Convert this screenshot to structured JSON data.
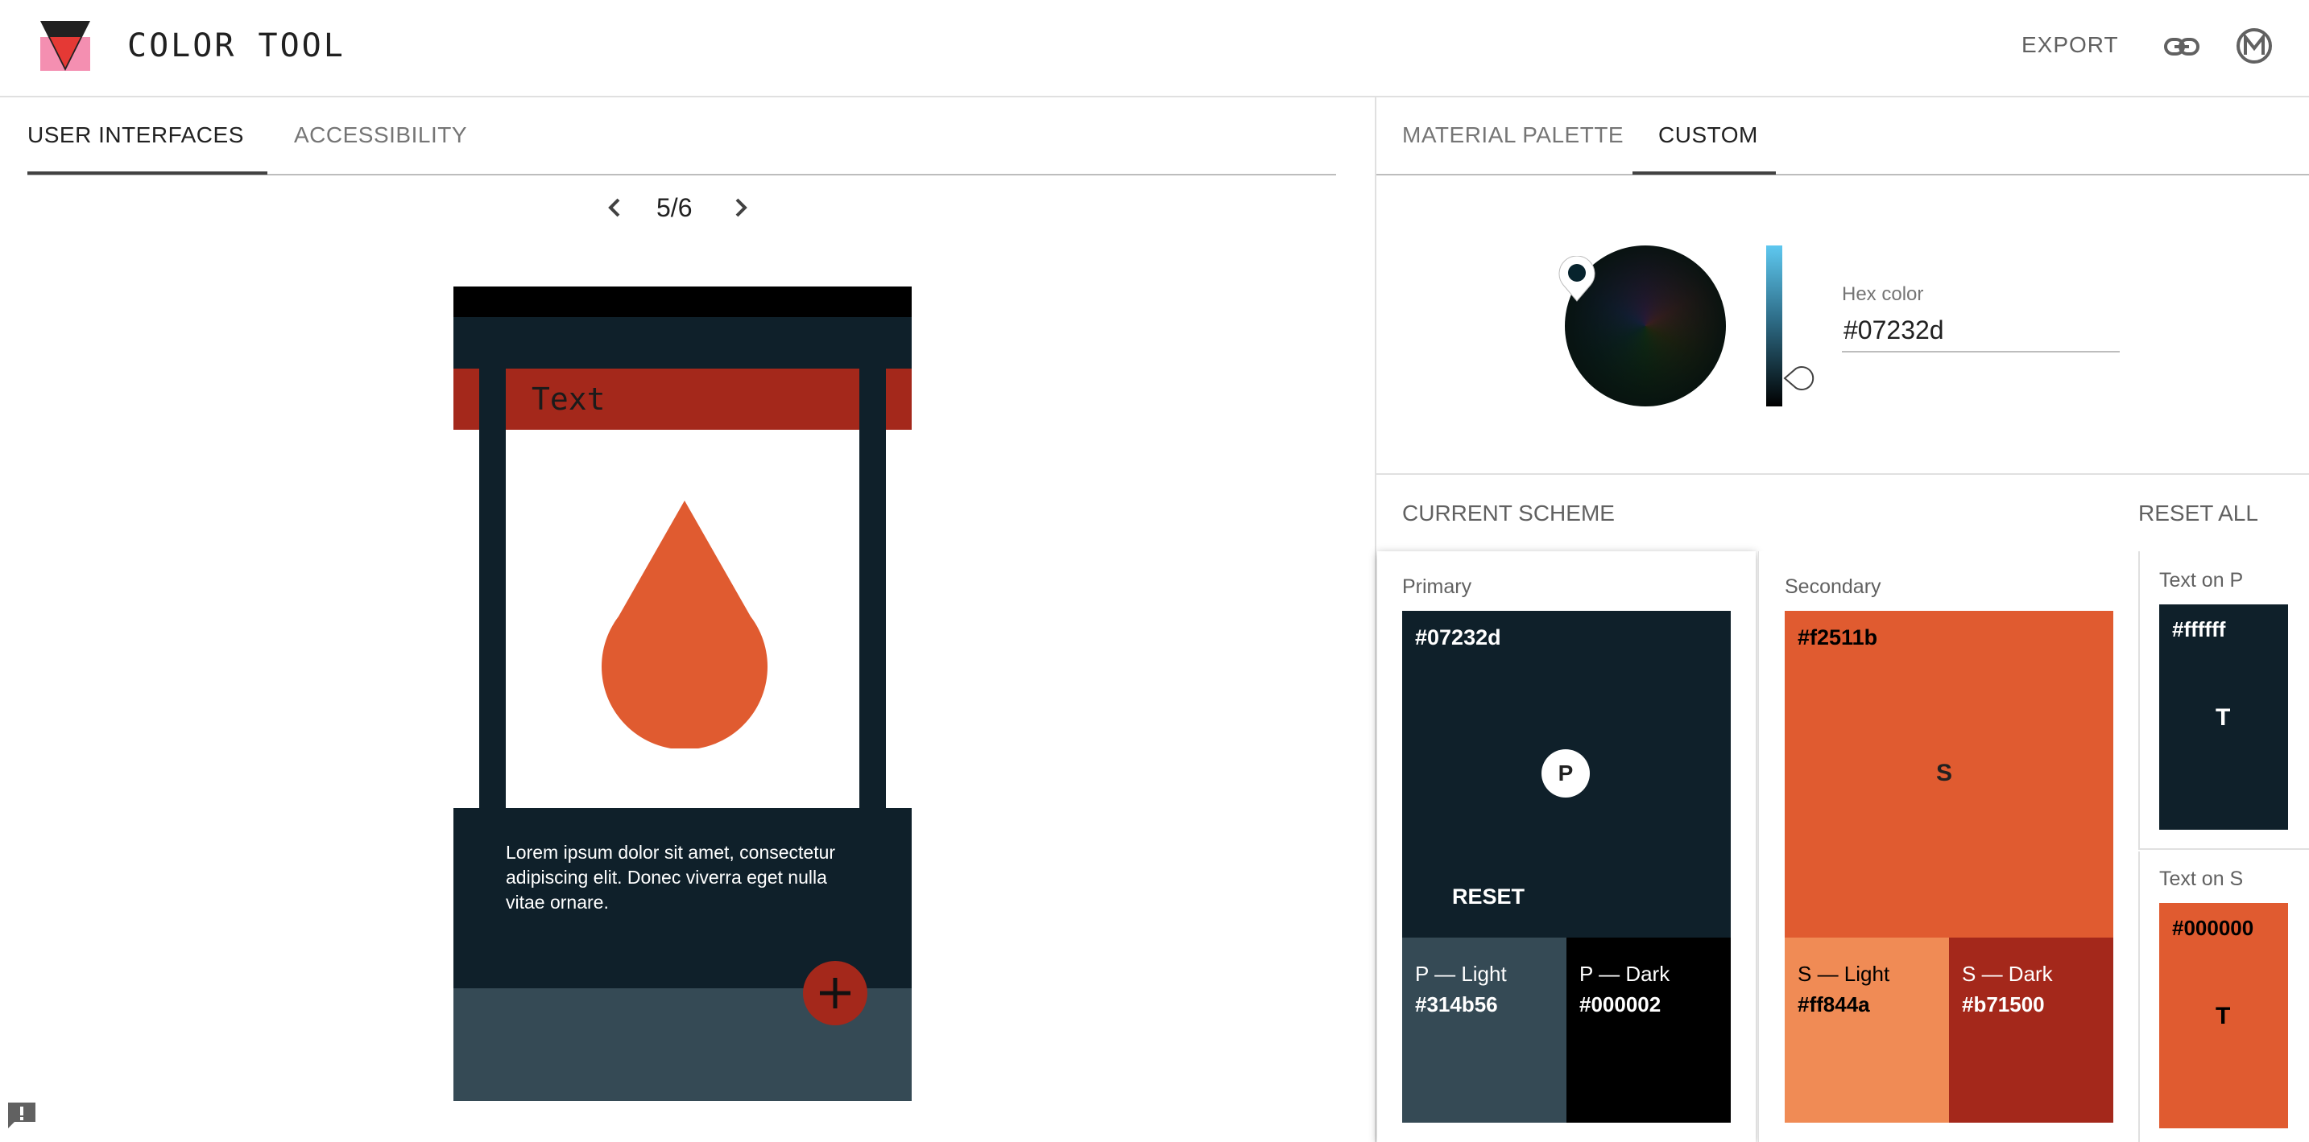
{
  "header": {
    "title": "COLOR TOOL",
    "export_label": "EXPORT",
    "link_icon": "link-icon",
    "material_icon": "material-icon"
  },
  "left_panel": {
    "tabs": [
      {
        "label": "USER INTERFACES",
        "active": true
      },
      {
        "label": "ACCESSIBILITY",
        "active": false
      }
    ],
    "pager": {
      "text": "5/6"
    },
    "preview": {
      "card_title": "Text",
      "body_text": "Lorem ipsum dolor sit amet, consectetur adipiscing elit. Donec viverra eget nulla vitae ornare.",
      "fab_icon": "plus-icon",
      "image_icon": "drop-icon"
    }
  },
  "right_panel": {
    "tabs": [
      {
        "label": "MATERIAL PALETTE",
        "active": false
      },
      {
        "label": "CUSTOM",
        "active": true
      }
    ],
    "picker": {
      "hex_label": "Hex color",
      "hex_value": "#07232d"
    },
    "scheme": {
      "title": "CURRENT SCHEME",
      "reset_all_label": "RESET ALL",
      "primary": {
        "label": "Primary",
        "hex": "#07232d",
        "badge": "P",
        "reset_label": "RESET",
        "light_title": "P — Light",
        "light_hex": "#314b56",
        "dark_title": "P — Dark",
        "dark_hex": "#000002"
      },
      "secondary": {
        "label": "Secondary",
        "hex": "#f2511b",
        "badge": "S",
        "light_title": "S — Light",
        "light_hex": "#ff844a",
        "dark_title": "S — Dark",
        "dark_hex": "#b71500"
      },
      "text_on_p": {
        "label": "Text on P",
        "hex": "#ffffff",
        "glyph": "T"
      },
      "text_on_s": {
        "label": "Text on S",
        "hex": "#000000",
        "glyph": "T"
      }
    }
  },
  "colors": {
    "primary": "#0f202a",
    "primary_light": "#354a55",
    "primary_dark": "#000000",
    "secondary": "#e05b30",
    "secondary_light": "#f08b55",
    "secondary_dark": "#a4281b",
    "logo_pink": "#f48fb1",
    "logo_red": "#e53935"
  }
}
